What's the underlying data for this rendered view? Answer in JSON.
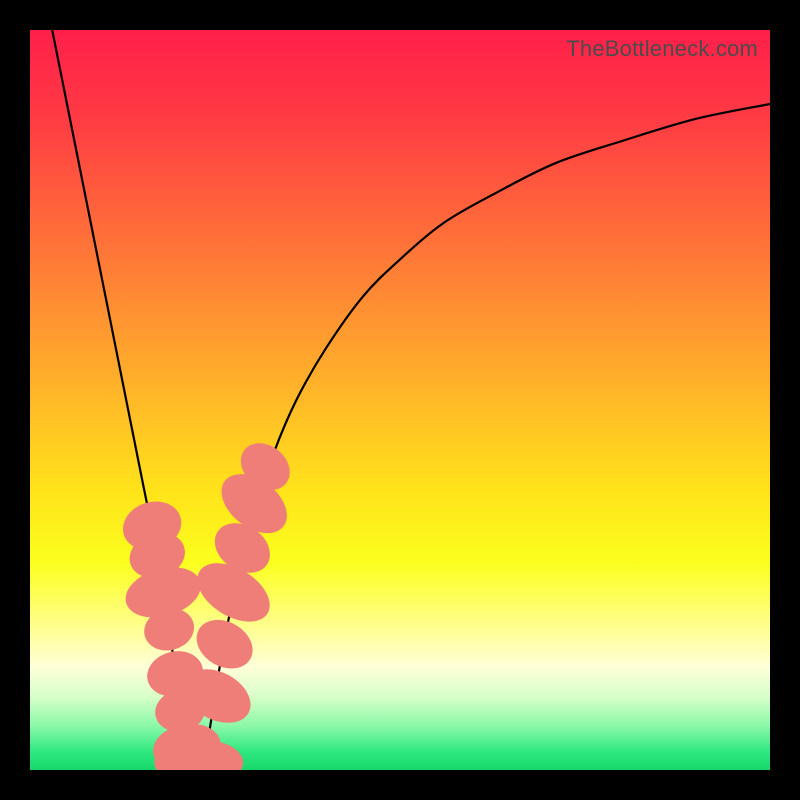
{
  "watermark": {
    "text": "TheBottleneck.com"
  },
  "colors": {
    "frame": "#000000",
    "curve_stroke": "#000000",
    "marker_fill": "#ef7e78",
    "gradient_stops": [
      {
        "offset": 0.0,
        "color": "#ff1f4a"
      },
      {
        "offset": 0.12,
        "color": "#ff3b44"
      },
      {
        "offset": 0.3,
        "color": "#ff7638"
      },
      {
        "offset": 0.48,
        "color": "#ffb22a"
      },
      {
        "offset": 0.62,
        "color": "#ffe21a"
      },
      {
        "offset": 0.72,
        "color": "#fbff1e"
      },
      {
        "offset": 0.8,
        "color": "#fffe86"
      },
      {
        "offset": 0.86,
        "color": "#ffffd8"
      },
      {
        "offset": 0.9,
        "color": "#d9ffc9"
      },
      {
        "offset": 0.94,
        "color": "#8cf8a8"
      },
      {
        "offset": 0.975,
        "color": "#2fe87f"
      },
      {
        "offset": 1.0,
        "color": "#17d86c"
      }
    ]
  },
  "chart_data": {
    "type": "line",
    "title": "",
    "xlabel": "",
    "ylabel": "",
    "xlim": [
      0,
      100
    ],
    "ylim": [
      0,
      100
    ],
    "x_optimum": 22,
    "series": [
      {
        "name": "bottleneck-curve",
        "x": [
          3,
          5,
          7,
          9,
          11,
          13,
          15,
          17,
          18,
          19,
          20,
          21,
          22,
          23,
          24,
          25,
          26,
          28,
          30,
          33,
          36,
          40,
          45,
          50,
          56,
          63,
          71,
          80,
          90,
          100
        ],
        "y": [
          100,
          90,
          80,
          70,
          60,
          50,
          40,
          30,
          24,
          18,
          10,
          4,
          1,
          1,
          4,
          10,
          16,
          26,
          34,
          43,
          50,
          57,
          64,
          69,
          74,
          78,
          82,
          85,
          88,
          90
        ]
      }
    ],
    "markers": {
      "name": "highlighted-points",
      "points": [
        {
          "x": 16.5,
          "y": 33,
          "rx": 2.8,
          "ry": 3.6,
          "rot": 72
        },
        {
          "x": 17.2,
          "y": 29,
          "rx": 2.6,
          "ry": 3.4,
          "rot": 72
        },
        {
          "x": 18.0,
          "y": 24,
          "rx": 2.8,
          "ry": 4.8,
          "rot": 74
        },
        {
          "x": 18.8,
          "y": 19,
          "rx": 2.4,
          "ry": 3.0,
          "rot": 75
        },
        {
          "x": 19.6,
          "y": 13,
          "rx": 2.6,
          "ry": 3.4,
          "rot": 76
        },
        {
          "x": 20.3,
          "y": 8,
          "rx": 2.4,
          "ry": 3.0,
          "rot": 78
        },
        {
          "x": 21.2,
          "y": 3,
          "rx": 2.8,
          "ry": 4.2,
          "rot": 80
        },
        {
          "x": 22.2,
          "y": 1,
          "rx": 5.0,
          "ry": 2.6,
          "rot": 0
        },
        {
          "x": 23.6,
          "y": 1,
          "rx": 4.8,
          "ry": 2.6,
          "rot": 0
        },
        {
          "x": 25.3,
          "y": 10,
          "rx": 2.8,
          "ry": 4.4,
          "rot": -62
        },
        {
          "x": 26.3,
          "y": 17,
          "rx": 2.6,
          "ry": 3.6,
          "rot": -60
        },
        {
          "x": 27.5,
          "y": 24,
          "rx": 2.8,
          "ry": 5.0,
          "rot": -58
        },
        {
          "x": 28.7,
          "y": 30,
          "rx": 2.6,
          "ry": 3.6,
          "rot": -56
        },
        {
          "x": 30.3,
          "y": 36,
          "rx": 2.8,
          "ry": 4.6,
          "rot": -52
        },
        {
          "x": 31.8,
          "y": 41,
          "rx": 2.4,
          "ry": 3.2,
          "rot": -50
        }
      ]
    }
  }
}
